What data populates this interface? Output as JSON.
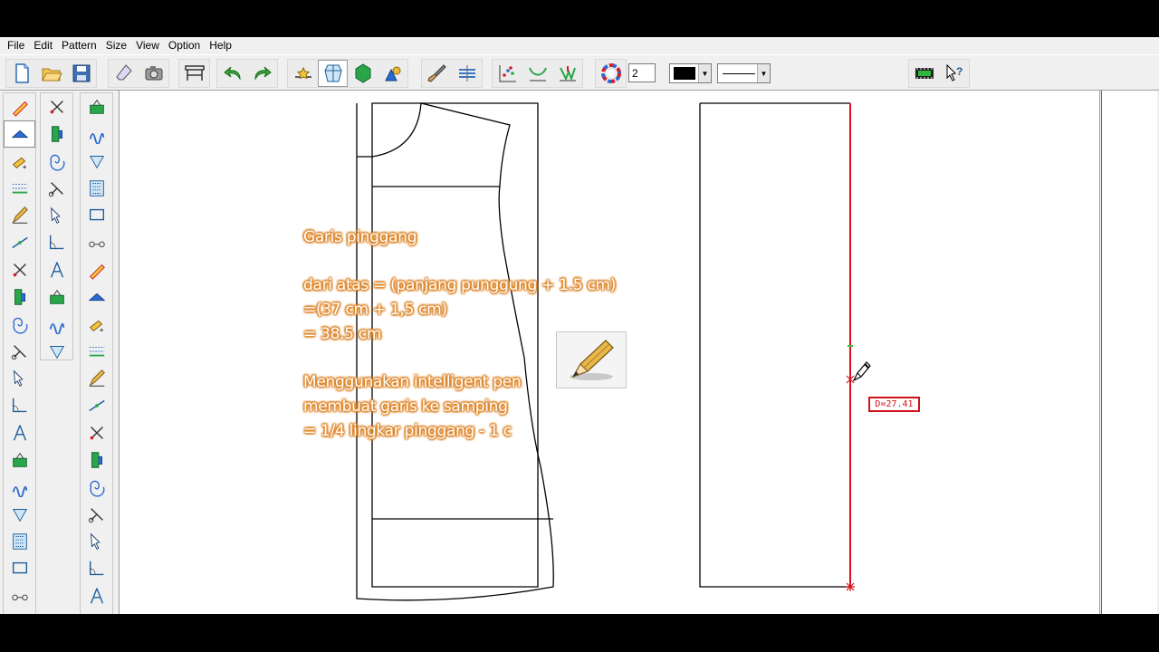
{
  "menu": [
    "File",
    "Edit",
    "Pattern",
    "Size",
    "View",
    "Option",
    "Help"
  ],
  "toolbar": {
    "groups": [
      [
        "new-file-icon",
        "open-folder-icon",
        "save-icon"
      ],
      [
        "eraser-icon",
        "camera-icon"
      ],
      [
        "table-icon"
      ],
      [
        "undo-icon",
        "redo-icon"
      ],
      [
        "grade-point-icon",
        "show-grid-icon",
        "fill-piece-icon",
        "piece-colors-icon"
      ],
      [
        "brush-icon",
        "layer-icon"
      ],
      [
        "points-icon",
        "curve-icon",
        "seam-icon"
      ],
      [
        "color-wheel-icon"
      ]
    ],
    "line_thickness": "2",
    "line_color": "#000000",
    "line_style": "solid"
  },
  "palette_left": [
    "select-arrow-icon",
    "intelligent-pen-icon",
    "rectangle-icon",
    "corner-adjust-icon",
    "point-on-line-icon",
    "measure-curve-icon",
    "compass-icon",
    "scissors-cut-icon",
    "ruler-pen-icon",
    "dart-icon",
    "notch-pleat-icon",
    "fold-icon",
    "pleat-icon",
    "spiral-icon",
    "add-seam-icon",
    "fan-cut-icon",
    "cut-scissors-icon",
    "seam-allowance-icon",
    "texture-icon"
  ],
  "palette_mid": [
    "piece-detail-icon",
    "piece-list-icon",
    "curve-line-icon",
    "fill-piece-icon-2",
    "piece-layout-icon",
    "color-arc-icon",
    "align-pieces-icon",
    "button-row-icon",
    "pattern-detail-icon",
    "pattern-grid-icon"
  ],
  "palette_right": [
    "select-piece-icon",
    "pocket-icon",
    "dotted-piece-icon",
    "sleeve-icon",
    "landscape-icon",
    "measure-line-icon",
    "button-icon",
    "texture-piece-icon",
    "piece-rotate-icon",
    "sewing-machine-icon",
    "piece-transfer-icon",
    "piece-flip-icon",
    "red-line-edit-icon",
    "edit-piece-icon",
    "color-piece-icon",
    "book-icon",
    "mirror-piece-icon",
    "paint-piece-icon",
    "duplicate-piece-icon"
  ],
  "notes": {
    "line1": "Garis pinggang",
    "line2": "dari atas = (panjang punggung + 1.5 cm)",
    "line3": " =(37 cm + 1,5 cm)",
    "line4": " = 38.5 cm",
    "line5": "Menggunakan intelligent pen",
    "line6": "membuat garis  ke samping",
    "line7": "= 1/4 lingkar pinggang  - 1 c"
  },
  "readout": {
    "length": "D=27.41"
  },
  "colors": {
    "accent_line": "#d8121c",
    "note_outline": "#e3892a",
    "pattern_stroke": "#000000"
  }
}
